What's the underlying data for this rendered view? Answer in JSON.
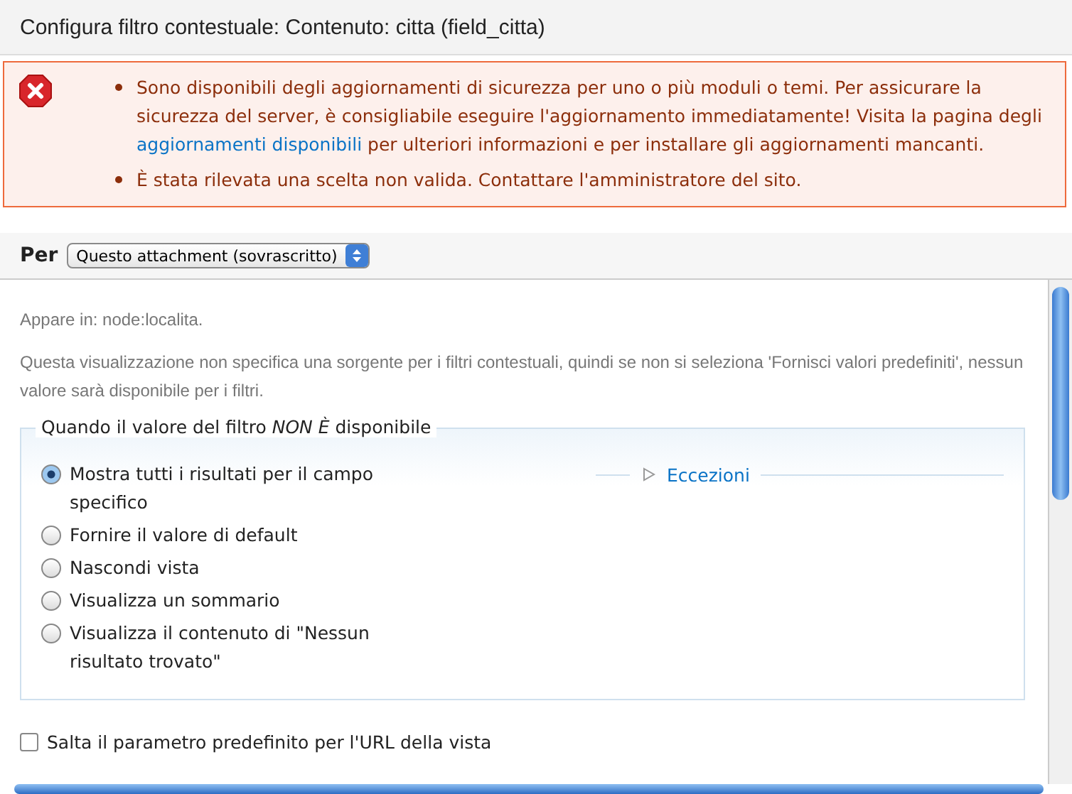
{
  "window": {
    "title": "Configura filtro contestuale: Contenuto: citta (field_citta)"
  },
  "messages": [
    {
      "parts": [
        {
          "kind": "text",
          "text": "Sono disponibili degli aggiornamenti di sicurezza per uno o più moduli o temi. Per assicurare la sicurezza del server, è consigliabile eseguire l'aggiornamento immediatamente! Visita la pagina degli "
        },
        {
          "kind": "link",
          "text": "aggiornamenti disponibili"
        },
        {
          "kind": "text",
          "text": " per ulteriori informazioni e per installare gli aggiornamenti mancanti."
        }
      ]
    },
    {
      "parts": [
        {
          "kind": "text",
          "text": "È stata rilevata una scelta non valida. Contattare l'amministratore del sito."
        }
      ]
    }
  ],
  "for_bar": {
    "label": "Per",
    "select": "Questo attachment (sovrascritto)"
  },
  "appears_in": "Appare in: node:localita.",
  "description": "Questa visualizzazione non specifica una sorgente per i filtri contestuali, quindi se non si seleziona 'Fornisci valori predefiniti', nessun valore sarà disponibile per i filtri.",
  "fieldset": {
    "legend": "Quando il valore del filtro *NON È* disponibile",
    "options": [
      {
        "label": "Mostra tutti i risultati per il campo specifico",
        "selected": true
      },
      {
        "label": "Fornire il valore di default",
        "selected": false
      },
      {
        "label": "Nascondi vista",
        "selected": false
      },
      {
        "label": "Visualizza un sommario",
        "selected": false
      },
      {
        "label": "Visualizza il contenuto di \"Nessun risultato trovato\"",
        "selected": false
      }
    ],
    "exceptions": {
      "label": "Eccezioni",
      "expanded": false
    }
  },
  "skip_default": {
    "label": "Salta il parametro predefinito per l'URL della vista",
    "checked": false
  }
}
